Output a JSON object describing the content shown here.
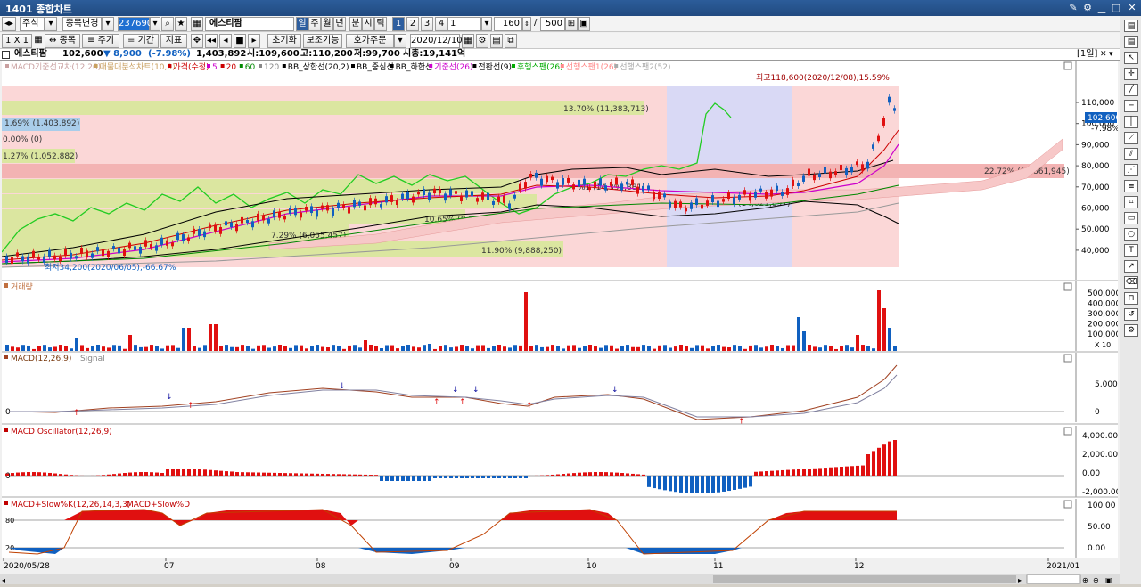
{
  "window": {
    "title": "1401 종합차트"
  },
  "toolbar1": {
    "category": "주식",
    "change_label": "종목변경",
    "code": "237690",
    "name": "에스티팜",
    "periods": [
      "일",
      "주",
      "월",
      "년",
      "분",
      "시",
      "틱"
    ],
    "nums": [
      "1",
      "2",
      "3",
      "4"
    ],
    "interval": "1",
    "count": "160",
    "total": "500",
    "slash": "/"
  },
  "toolbar2": {
    "buttons": [
      "1 X 1",
      "종목",
      "주기",
      "기간",
      "지표"
    ],
    "reset": "초기화",
    "aux": "보조기능",
    "order": "호가주문",
    "date": "2020/12/10"
  },
  "stock": {
    "name": "에스티팜",
    "price": "102,600",
    "change": "▼ 8,900",
    "rate": "(-7.98%)",
    "volume": "1,403,892",
    "open": "시:109,600",
    "high": "고:110,200",
    "low": "저:99,700",
    "mcap": "시총:19,141억",
    "freq": "[1일]"
  },
  "main_panel": {
    "legend": [
      {
        "text": "MACD기준선교차(12,26)",
        "color": "#c9a0a0"
      },
      {
        "text": "매물대분석차트(10,0)",
        "color": "#c9a060"
      },
      {
        "text": "가격(수정)",
        "color": "#cc0000"
      },
      {
        "text": "5",
        "color": "#cc00cc"
      },
      {
        "text": "20",
        "color": "#cc0000"
      },
      {
        "text": "60",
        "color": "#008800"
      },
      {
        "text": "120",
        "color": "#888888"
      },
      {
        "text": "BB_상한선(20,2)",
        "color": "#000000"
      },
      {
        "text": "BB_중심선",
        "color": "#000000"
      },
      {
        "text": "BB_하한선",
        "color": "#000000"
      },
      {
        "text": "기준선(26)",
        "color": "#cc00cc"
      },
      {
        "text": "전환선(9)",
        "color": "#000000"
      },
      {
        "text": "후행스팬(26)",
        "color": "#00aa00"
      },
      {
        "text": "선행스팬1(26)",
        "color": "#ff8888"
      },
      {
        "text": "선행스팬2(52)",
        "color": "#aaaaaa"
      }
    ],
    "y_ticks": [
      "110,000",
      "100,000",
      "90,000",
      "80,000",
      "70,000",
      "60,000",
      "50,000",
      "40,000"
    ],
    "price_box": "102,600",
    "price_rate": "-7.98%",
    "high_label": "최고118,600(2020/12/08),15.59%",
    "low_label": "최저34,200(2020/06/05),-66.67%",
    "volume_labels": {
      "a": "13.70% (11,383,713)",
      "b": "1.69% (1,403,892)",
      "c": "0.00% (0)",
      "d": "1.27% (1,052,882)",
      "e": "22.72% (18,861,945)",
      "f": "(14,021,897)",
      "g": "10.65% (8,849,896)",
      "h": "7.29% (6,055,457)",
      "i": "11.90% (9,888,250)",
      "j": "%1 (14,393,881)"
    }
  },
  "volume_panel": {
    "title": "거래량",
    "y_ticks": [
      "500,000",
      "400,000",
      "300,000",
      "200,000",
      "100,000"
    ],
    "unit": "X 10"
  },
  "macd_panel": {
    "title": "MACD(12,26,9)",
    "signal": "Signal",
    "y_ticks": [
      "5,000",
      "0"
    ],
    "zero": "0"
  },
  "osc_panel": {
    "title": "MACD Oscillator(12,26,9)",
    "y_ticks": [
      "4,000.00",
      "2,000.00",
      "0.00",
      "-2,000.00"
    ],
    "zero": "0"
  },
  "slow_panel": {
    "title": "MACD+Slow%K(12,26,14,3,3)",
    "title2": "MACD+Slow%D",
    "y_ticks": [
      "100.00",
      "50.00",
      "0.00"
    ],
    "lines": [
      "80",
      "20"
    ]
  },
  "x_axis": [
    "2020/05/28",
    "07",
    "08",
    "09",
    "10",
    "11",
    "12",
    "2021/01"
  ],
  "colors": {
    "up": "#e01010",
    "down": "#1060c0",
    "accent": "#2f5f9f"
  }
}
